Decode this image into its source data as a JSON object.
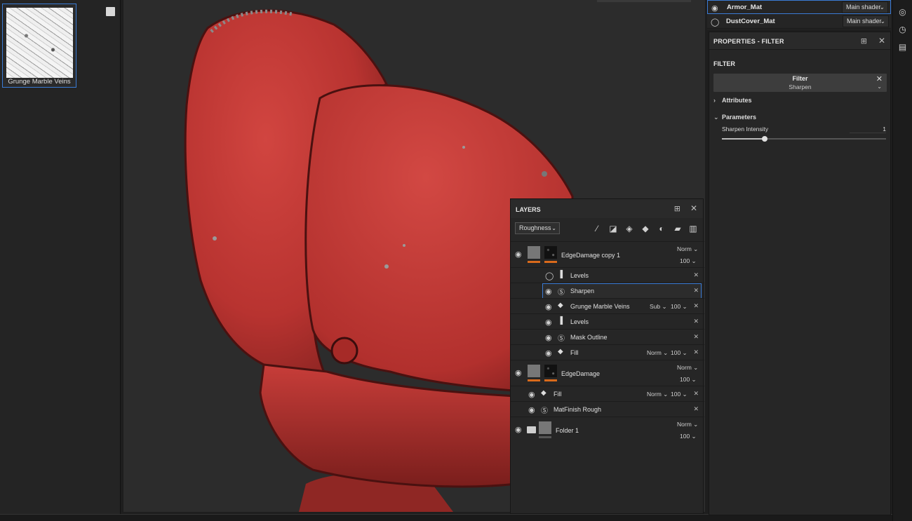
{
  "shelf": {
    "item_label": "Grunge Marble Veins"
  },
  "texture_sets": [
    {
      "name": "Armor_Mat",
      "shader": "Main shader",
      "selected": true
    },
    {
      "name": "DustCover_Mat",
      "shader": "Main shader",
      "selected": false
    }
  ],
  "properties": {
    "title": "PROPERTIES - FILTER",
    "section": "FILTER",
    "filter_label": "Filter",
    "filter_value": "Sharpen",
    "group_attributes": "Attributes",
    "group_parameters": "Parameters",
    "param_label": "Sharpen Intensity",
    "param_value": "1",
    "slider_fraction": 0.26
  },
  "layers": {
    "title": "LAYERS",
    "channel": "Roughness",
    "tools": [
      "add-effect-icon",
      "add-mask-icon",
      "add-layer-icon",
      "add-fill-layer-icon",
      "add-smart-material-icon",
      "add-folder-icon",
      "delete-icon"
    ],
    "rows": {
      "edgedamage_copy": {
        "name": "EdgeDamage copy 1",
        "blend": "Norm",
        "opacity": "100"
      },
      "levels_1": {
        "name": "Levels"
      },
      "sharpen": {
        "name": "Sharpen"
      },
      "grunge": {
        "name": "Grunge Marble Veins",
        "blend": "Sub",
        "opacity": "100"
      },
      "levels_2": {
        "name": "Levels"
      },
      "mask_outline": {
        "name": "Mask Outline"
      },
      "fill_1": {
        "name": "Fill",
        "blend": "Norm",
        "opacity": "100"
      },
      "edgedamage": {
        "name": "EdgeDamage",
        "blend": "Norm",
        "opacity": "100"
      },
      "fill_2": {
        "name": "Fill",
        "blend": "Norm",
        "opacity": "100"
      },
      "matfinish": {
        "name": "MatFinish Rough"
      },
      "folder": {
        "name": "Folder 1",
        "blend": "Norm",
        "opacity": "100"
      }
    }
  },
  "colors": {
    "accent": "#3a7bd5",
    "mask_bar": "#d96a1b",
    "paint_red": "#c43a35"
  }
}
